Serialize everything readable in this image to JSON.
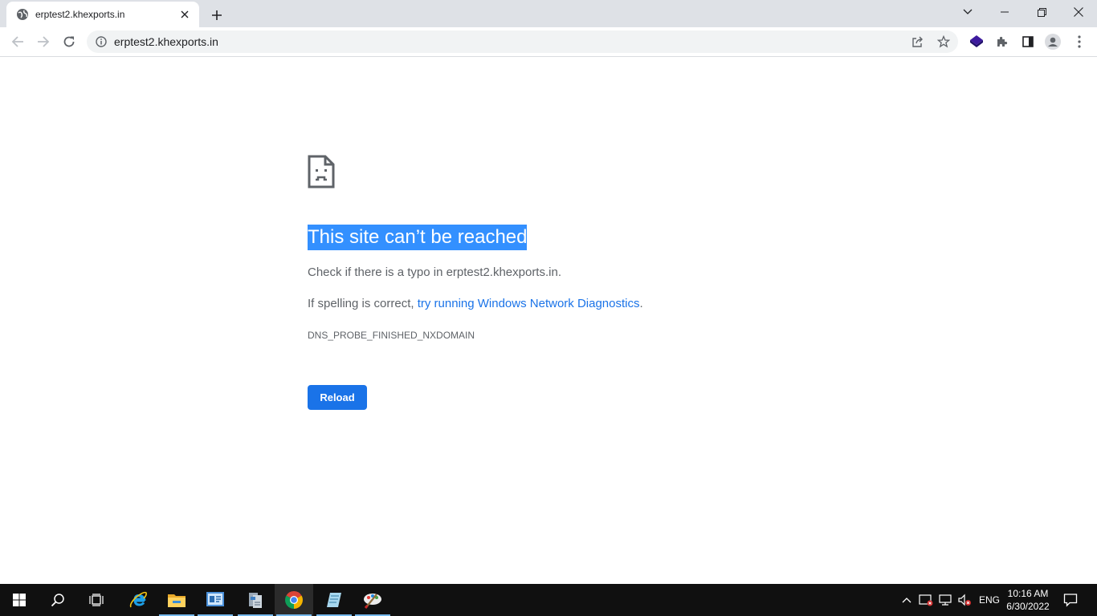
{
  "browser": {
    "tab": {
      "title": "erptest2.khexports.in",
      "favicon": "globe-icon"
    },
    "window_controls": [
      "chevron-down-icon",
      "minimize-icon",
      "restore-icon",
      "close-icon"
    ],
    "omnibox": {
      "url": "erptest2.khexports.in"
    },
    "toolbar_icons": [
      "back-icon",
      "forward-icon",
      "reload-icon",
      "share-icon",
      "star-icon",
      "extension-icon",
      "puzzle-icon",
      "side-panel-icon",
      "profile-icon",
      "menu-icon"
    ]
  },
  "error_page": {
    "icon": "sad-page-icon",
    "title": "This site can’t be reached",
    "p1": "Check if there is a typo in erptest2.khexports.in.",
    "p2_prefix": "If spelling is correct, ",
    "p2_link": "try running Windows Network Diagnostics",
    "p2_suffix": ".",
    "error_code": "DNS_PROBE_FINISHED_NXDOMAIN",
    "reload_label": "Reload",
    "selection_color": "#3390ff",
    "link_color": "#1a73e8"
  },
  "taskbar": {
    "apps": [
      "windows-start-icon",
      "search-icon",
      "task-view-icon",
      "internet-explorer-icon",
      "file-explorer-icon",
      "server-manager-icon",
      "app-icon",
      "chrome-icon",
      "notepad-icon",
      "paint-icon"
    ],
    "tray": {
      "language": "ENG",
      "time": "10:16 AM",
      "date": "6/30/2022"
    }
  }
}
